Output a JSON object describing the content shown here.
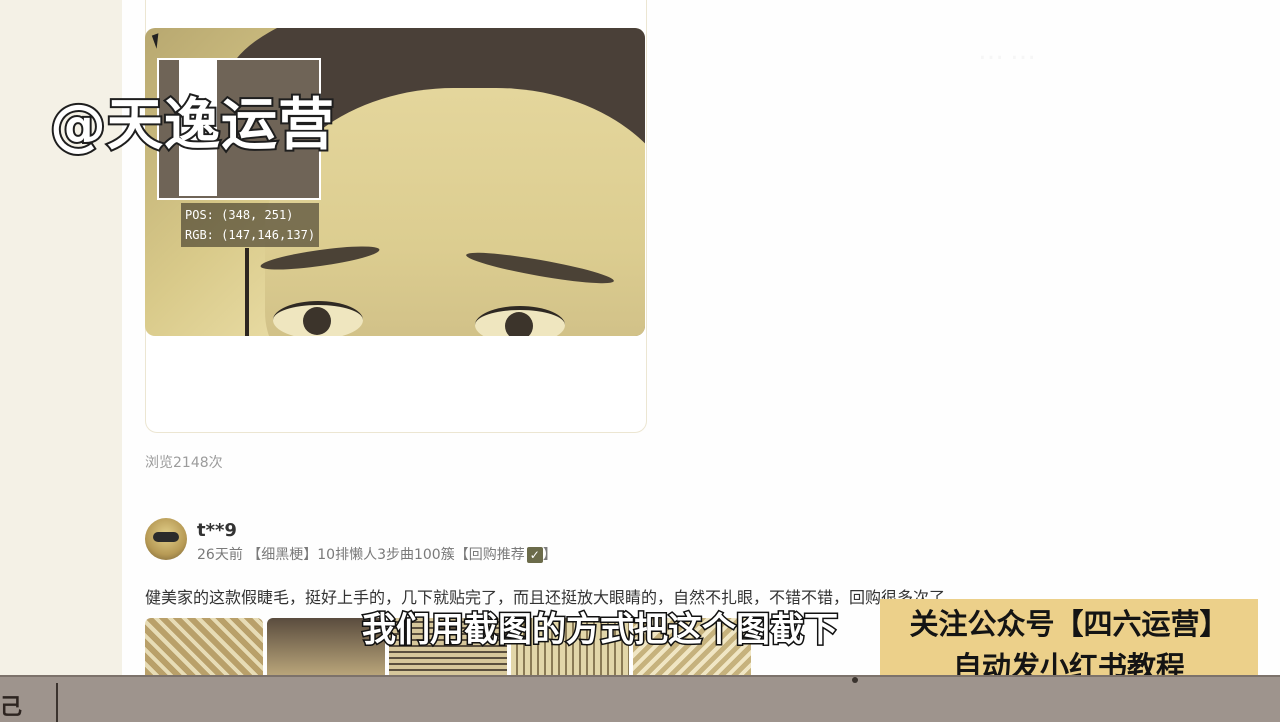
{
  "watermark": {
    "text": "@天逸运营"
  },
  "corner_logo": {
    "text": "……"
  },
  "screenshot_tool": {
    "pos_label": "POS:",
    "pos_value": "(348, 251)",
    "rgb_label": "RGB:",
    "rgb_value": "(147,146,137)"
  },
  "post": {
    "views": "浏览2148次"
  },
  "comment": {
    "username": "t**9",
    "meta": "26天前 【细黑梗】10排懒人3步曲100簇【回购推荐",
    "meta_end": "】",
    "check_icon": "✓",
    "text": "健美家的这款假睫毛，挺好上手的，几下就贴完了，而且还挺放大眼睛的，自然不扎眼，不错不错，回购很多次了"
  },
  "subtitle": {
    "text": "我们用截图的方式把这个图截下"
  },
  "promo": {
    "line1": "关注公众号【四六运营】",
    "line2": "自动发小红书教程"
  },
  "taskbar": {
    "start_glyph": "己"
  },
  "colors": {
    "promo_bg": "#ecd08a",
    "taskbar_bg": "#9e948d",
    "page_bg": "#ffffff"
  }
}
